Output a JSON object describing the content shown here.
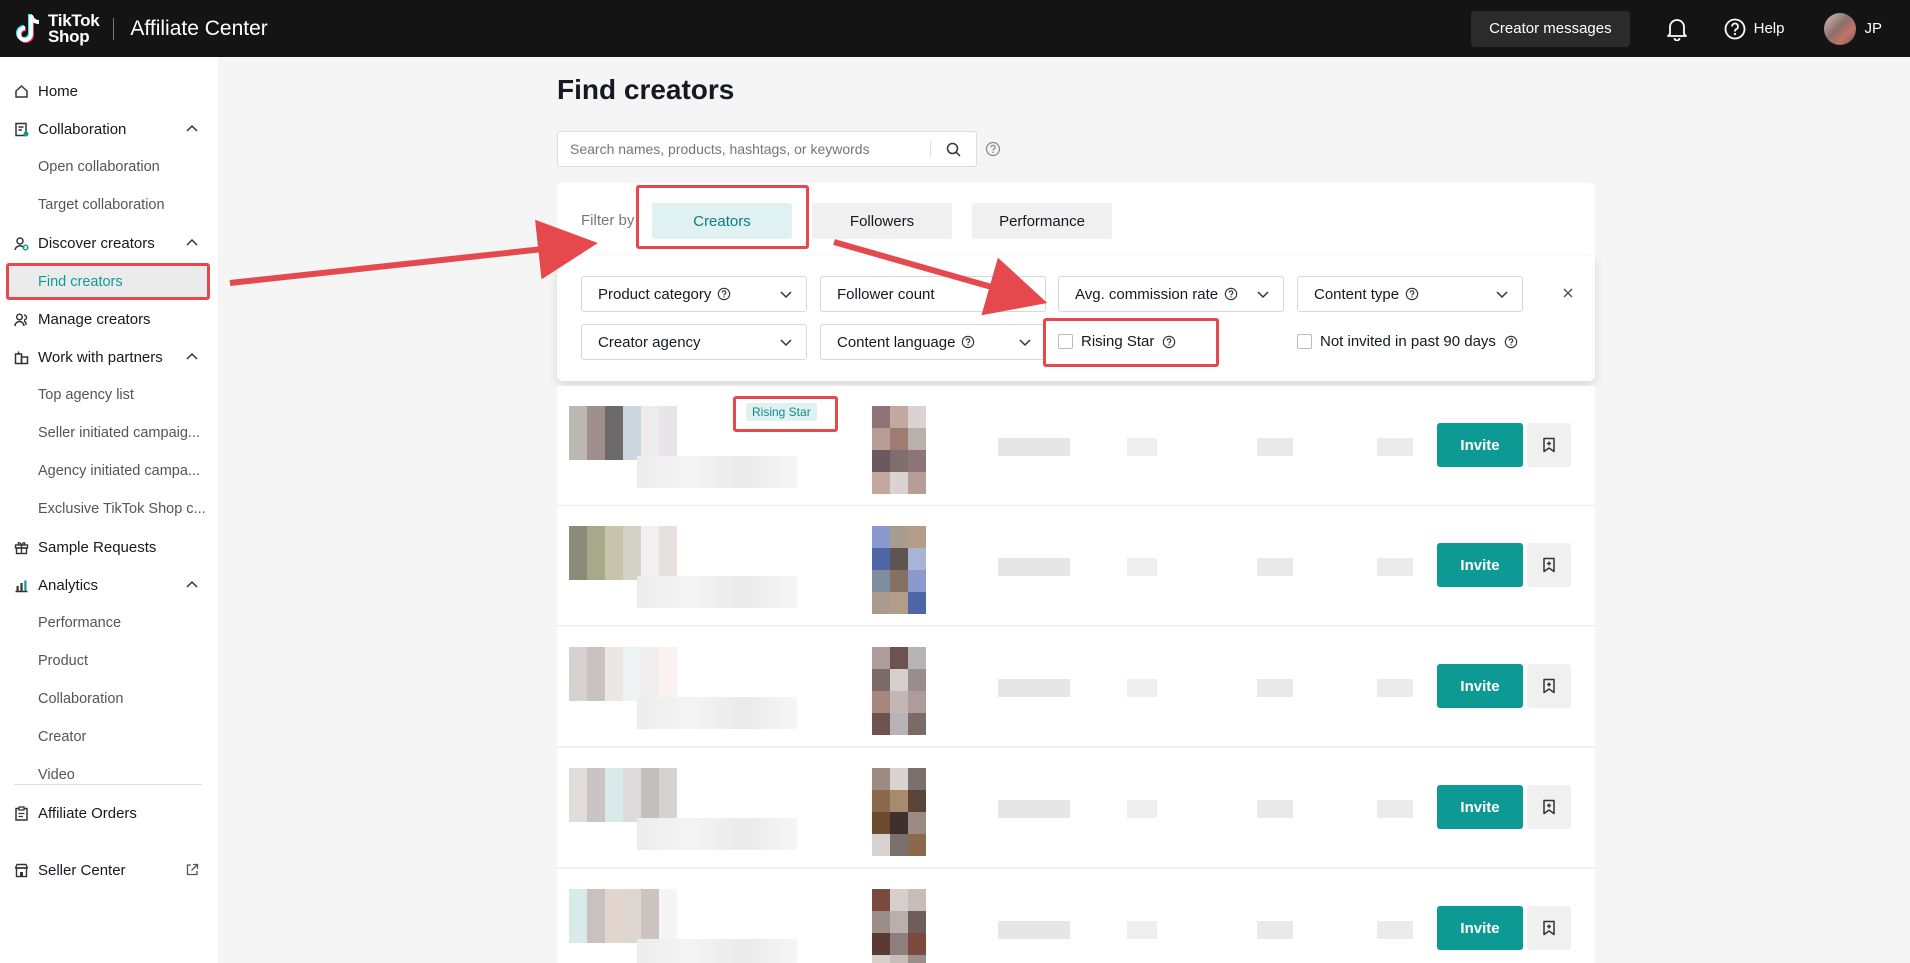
{
  "header": {
    "brand_line1": "TikTok",
    "brand_line2": "Shop",
    "app_title": "Affiliate Center",
    "creator_messages": "Creator messages",
    "help": "Help",
    "user_initials": "JP"
  },
  "sidebar": {
    "items": [
      {
        "label": "Home",
        "icon": "home-icon"
      },
      {
        "label": "Collaboration",
        "icon": "collaboration-icon"
      },
      {
        "label": "Open collaboration"
      },
      {
        "label": "Target collaboration"
      },
      {
        "label": "Discover creators",
        "icon": "discover-icon"
      },
      {
        "label": "Find creators"
      },
      {
        "label": "Manage creators",
        "icon": "manage-creators-icon"
      },
      {
        "label": "Work with partners",
        "icon": "partners-icon"
      },
      {
        "label": "Top agency list"
      },
      {
        "label": "Seller initiated campaig..."
      },
      {
        "label": "Agency initiated campa..."
      },
      {
        "label": "Exclusive TikTok Shop c..."
      },
      {
        "label": "Sample Requests",
        "icon": "gift-icon"
      },
      {
        "label": "Analytics",
        "icon": "analytics-icon"
      },
      {
        "label": "Performance"
      },
      {
        "label": "Product"
      },
      {
        "label": "Collaboration"
      },
      {
        "label": "Creator"
      },
      {
        "label": "Video"
      },
      {
        "label": "Affiliate Orders",
        "icon": "orders-icon"
      },
      {
        "label": "Seller Center",
        "icon": "store-icon"
      }
    ]
  },
  "main": {
    "title": "Find creators",
    "search_placeholder": "Search names, products, hashtags, or keywords",
    "filter_by": "Filter by",
    "tabs": [
      {
        "label": "Creators",
        "active": true
      },
      {
        "label": "Followers",
        "active": false
      },
      {
        "label": "Performance",
        "active": false
      }
    ],
    "filters": {
      "product_category": "Product category",
      "follower_count": "Follower count",
      "avg_commission_rate": "Avg. commission rate",
      "content_type": "Content type",
      "creator_agency": "Creator agency",
      "content_language": "Content language",
      "rising_star": "Rising Star",
      "not_invited": "Not invited in past 90 days"
    },
    "rising_star_tag": "Rising Star",
    "invite_label": "Invite"
  },
  "colors": {
    "accent": "#0e9a94",
    "annotation_red": "#e5484d",
    "topbar": "#141414"
  }
}
